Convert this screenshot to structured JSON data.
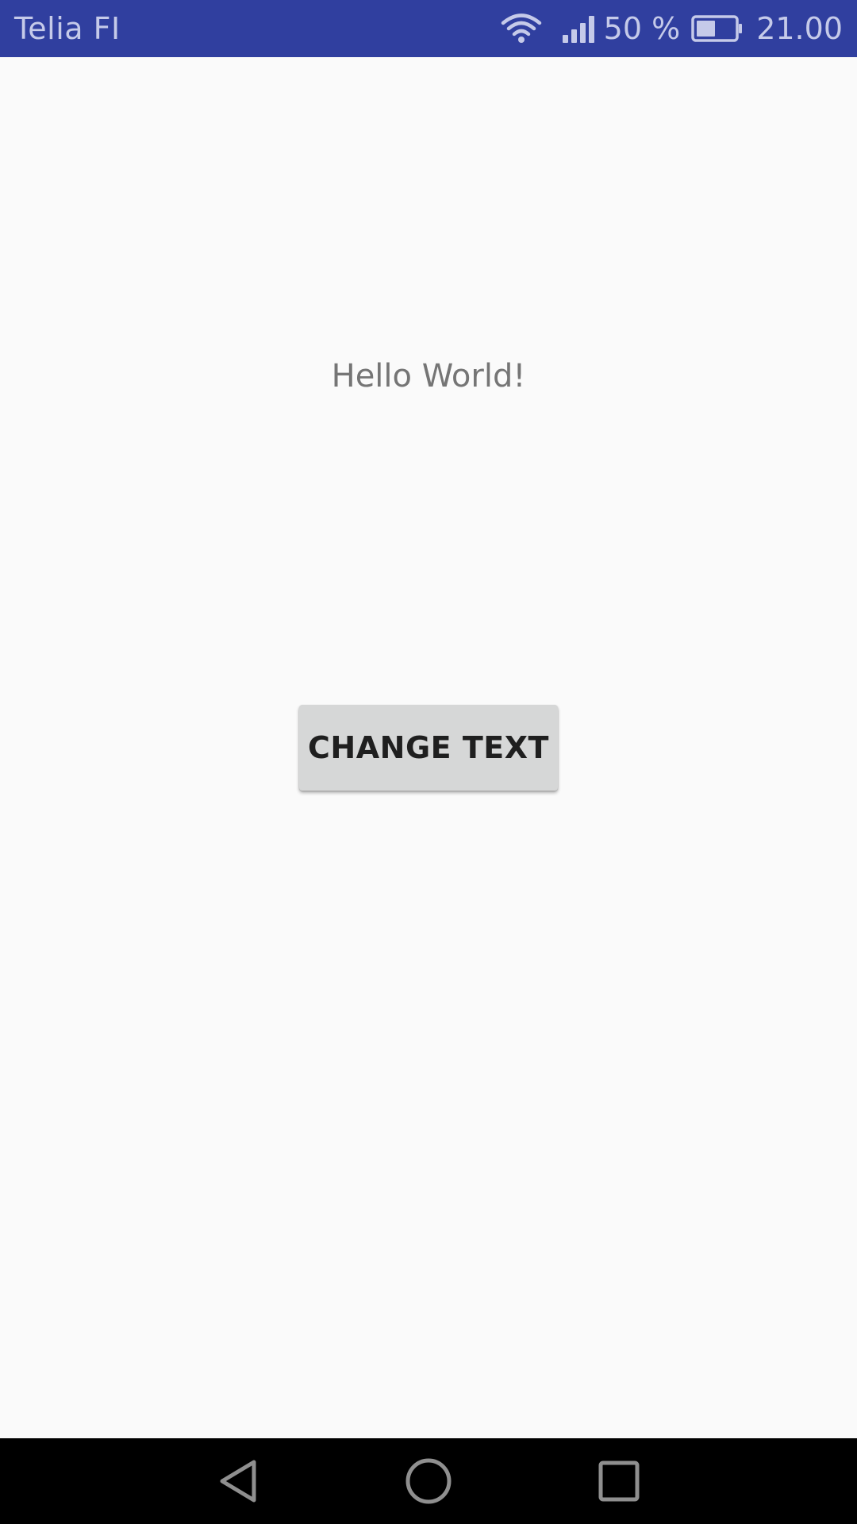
{
  "status_bar": {
    "carrier": "Telia FI",
    "battery_percent": "50 %",
    "battery_level": 0.5,
    "time": "21.00",
    "icons": [
      "wifi-icon",
      "signal-icon",
      "battery-icon"
    ],
    "background_color": "#303f9f"
  },
  "main": {
    "hello_text": "Hello World!",
    "button_label": "CHANGE TEXT"
  },
  "nav_bar": {
    "icons": [
      "back-icon",
      "home-icon",
      "recents-icon"
    ]
  }
}
